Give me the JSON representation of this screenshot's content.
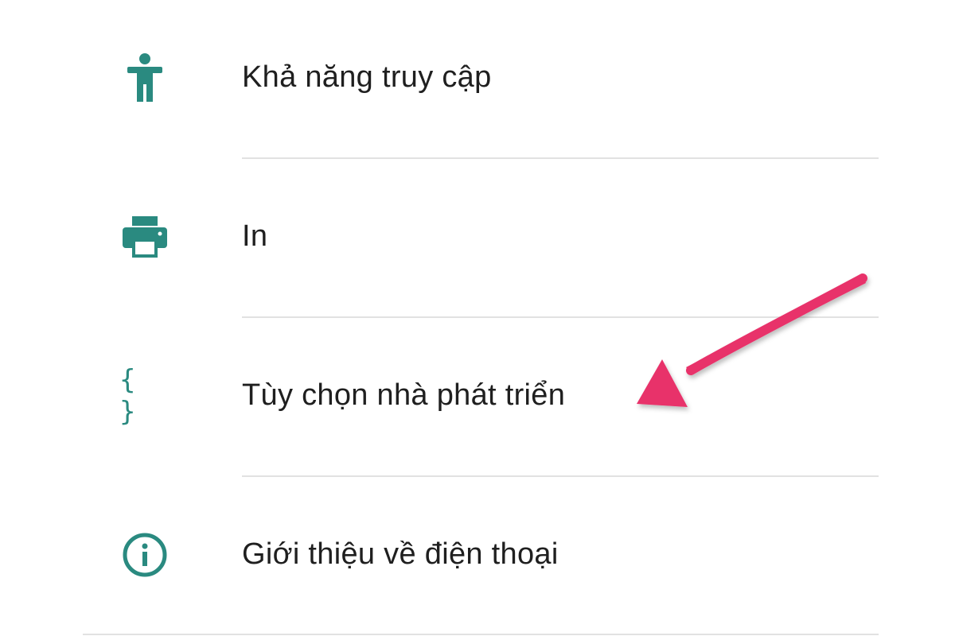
{
  "theme": {
    "icon_color": "#2a8a80",
    "text_color": "#1f1f1f",
    "divider_color": "#e2e2e2",
    "arrow_color": "#e8336b"
  },
  "settings": {
    "items": [
      {
        "label": "Khả năng truy cập",
        "icon": "accessibility-icon"
      },
      {
        "label": "In",
        "icon": "printer-icon"
      },
      {
        "label": "Tùy chọn nhà phát triển",
        "icon": "developer-braces-icon",
        "icon_glyph": "{ }"
      },
      {
        "label": "Giới thiệu về điện thoại",
        "icon": "info-icon"
      }
    ]
  },
  "annotation": {
    "arrow_target": "Tùy chọn nhà phát triển"
  }
}
